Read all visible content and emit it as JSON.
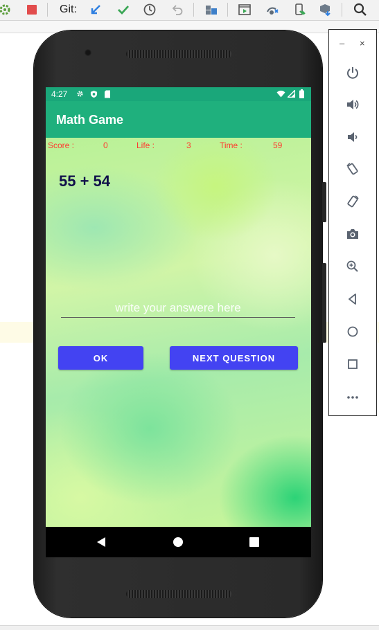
{
  "ide": {
    "git_label": "Git:",
    "toolbar_icons": [
      "build-icon",
      "stop-icon",
      "git-update-icon",
      "git-commit-icon",
      "history-icon",
      "rollback-icon",
      "project-structure-icon",
      "run-config-icon",
      "gradle-sync-icon",
      "avd-manager-icon",
      "sdk-manager-icon",
      "search-icon"
    ],
    "colors": {
      "toolbar_bg": "#f2f2f2",
      "highlight_line": "#fefbe6",
      "stop_red": "#e24c4c",
      "git_blue": "#2f7fe0",
      "git_green": "#3aa655"
    }
  },
  "status_bar": {
    "time": "4:27",
    "icons": [
      "settings-icon",
      "shield-icon",
      "sd-card-icon",
      "wifi-icon",
      "signal-icon",
      "battery-icon"
    ]
  },
  "app_bar": {
    "title": "Math Game"
  },
  "stats": {
    "score_label": "Score :",
    "score_value": "0",
    "life_label": "Life :",
    "life_value": "3",
    "time_label": "Time :",
    "time_value": "59"
  },
  "question": {
    "text": "55 + 54"
  },
  "answer_input": {
    "placeholder": "write your answere here",
    "value": ""
  },
  "buttons": {
    "ok_label": "OK",
    "next_label": "NEXT QUESTION"
  },
  "nav_bar": {
    "icons": [
      "back-icon",
      "home-icon",
      "recents-icon"
    ]
  },
  "emulator_panel": {
    "minimize_label": "–",
    "close_label": "×",
    "items": [
      "power-icon",
      "volume-up-icon",
      "volume-down-icon",
      "rotate-left-icon",
      "rotate-right-icon",
      "camera-icon",
      "zoom-icon",
      "back-icon",
      "home-icon",
      "overview-icon",
      "more-icon"
    ]
  },
  "colors": {
    "status_bar": "#1aa77a",
    "app_bar": "#1fb07d",
    "stats_text": "#ff3b30",
    "question_text": "#10104a",
    "button": "#4343f2",
    "nav_bar": "#000000"
  }
}
